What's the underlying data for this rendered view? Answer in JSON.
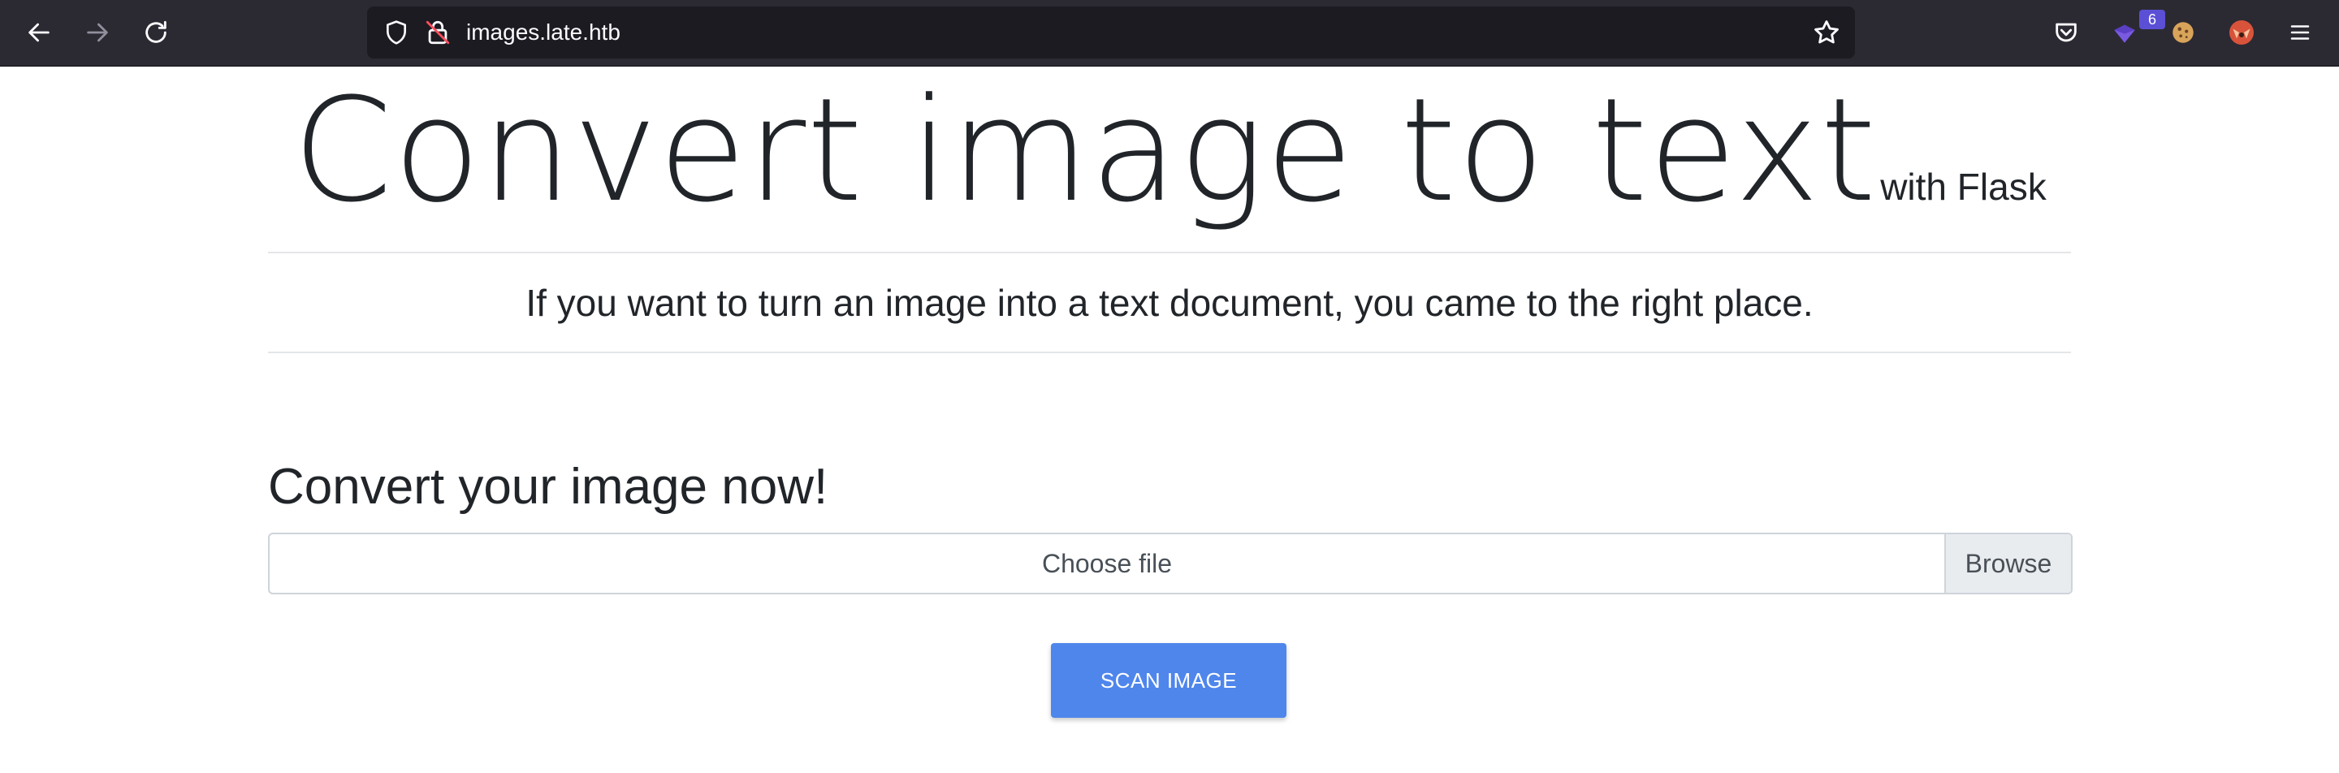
{
  "browser": {
    "url": "images.late.htb",
    "extension_badge": "6"
  },
  "page": {
    "title": "Convert image to text",
    "title_suffix": "with Flask",
    "lead": "If you want to turn an image into a text document, you came to the right place.",
    "section_title": "Convert your image now!",
    "file_input": {
      "label": "Choose file",
      "browse_label": "Browse"
    },
    "scan_button": "SCAN IMAGE"
  },
  "colors": {
    "toolbar": "#2b2a33",
    "urlbar": "#1c1b22",
    "button_primary": "#4f86ec",
    "text": "#212529"
  },
  "icons": [
    "back-arrow-icon",
    "forward-arrow-icon",
    "reload-icon",
    "shield-icon",
    "insecure-lock-icon",
    "bookmark-star-icon",
    "pocket-icon",
    "extension-icon",
    "cookie-icon",
    "fox-extension-icon",
    "hamburger-menu-icon"
  ]
}
